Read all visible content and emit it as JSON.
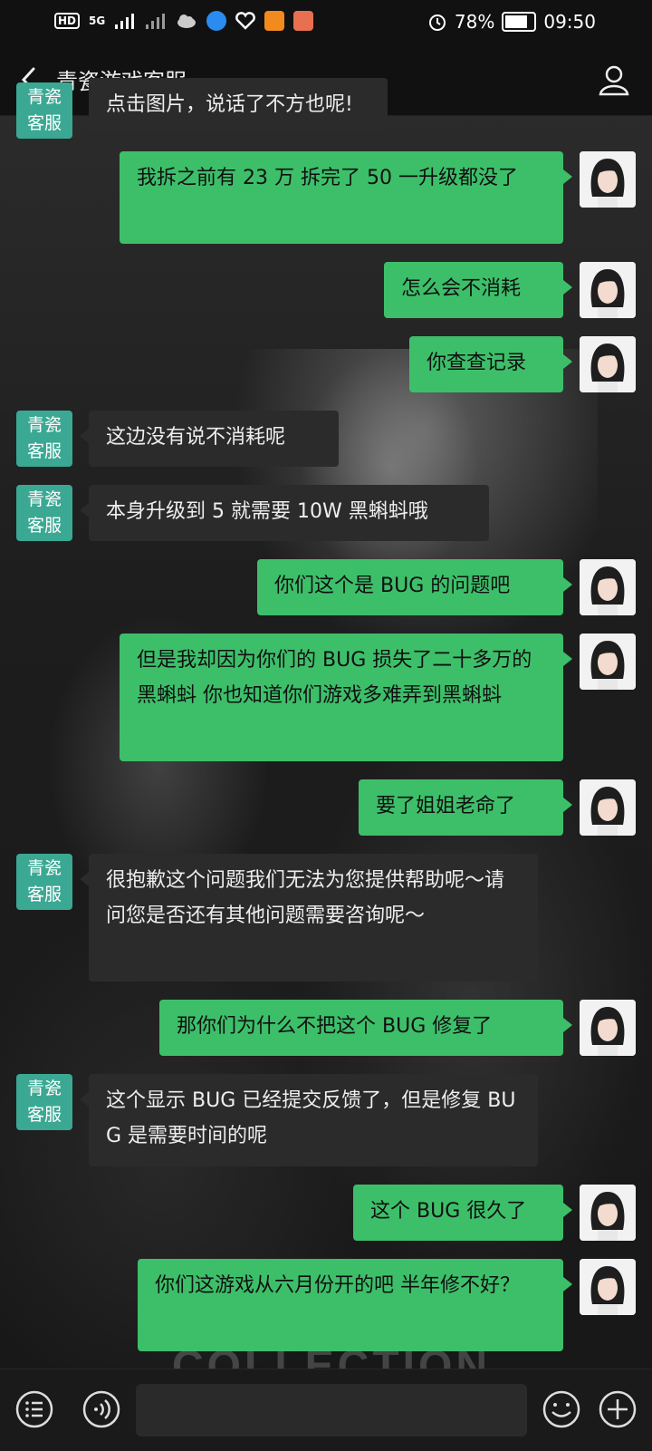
{
  "status_bar": {
    "hd": "HD",
    "network": "5G",
    "battery": "78%",
    "time": "09:50"
  },
  "nav": {
    "title": "青瓷游戏客服"
  },
  "agent_avatar": {
    "line1": "青瓷",
    "line2": "客服"
  },
  "partial_top": "点击图片，说话了不方也呢!",
  "messages": [
    {
      "from": "me",
      "text": "我拆之前有 23 万 拆完了 50  一升级都没了"
    },
    {
      "from": "me",
      "text": "怎么会不消耗"
    },
    {
      "from": "me",
      "text": "你查查记录"
    },
    {
      "from": "them",
      "text": "这边没有说不消耗呢"
    },
    {
      "from": "them",
      "text": "本身升级到 5 就需要 10W 黑蝌蚪哦"
    },
    {
      "from": "me",
      "text": "你们这个是 BUG 的问题吧"
    },
    {
      "from": "me",
      "text": "但是我却因为你们的 BUG 损失了二十多万的黑蝌蚪 你也知道你们游戏多难弄到黑蝌蚪"
    },
    {
      "from": "me",
      "text": "要了姐姐老命了"
    },
    {
      "from": "them",
      "text": "很抱歉这个问题我们无法为您提供帮助呢～请问您是否还有其他问题需要咨询呢～"
    },
    {
      "from": "me",
      "text": "那你们为什么不把这个 BUG 修复了"
    },
    {
      "from": "them",
      "text": "这个显示 BUG 已经提交反馈了，但是修复 BUG 是需要时间的呢"
    },
    {
      "from": "me",
      "text": "这个 BUG 很久了"
    },
    {
      "from": "me",
      "text": "你们这游戏从六月份开的吧 半年修不好？"
    }
  ],
  "background_text": "COLLECTION",
  "input": {
    "value": "",
    "placeholder": ""
  },
  "colors": {
    "my_bubble": "#3dbf6a",
    "their_bubble": "#2b2b2b",
    "agent_avatar": "#3ba893"
  }
}
